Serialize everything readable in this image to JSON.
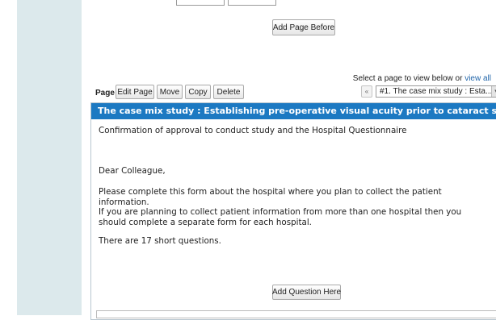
{
  "toolbar": {
    "add_page_before_label": "Add Page Before",
    "page_number": "Page #1",
    "edit_page_label": "Edit Page",
    "move_label": "Move",
    "copy_label": "Copy",
    "delete_label": "Delete"
  },
  "page_selector": {
    "instruction": "Select a page to view below or ",
    "view_all_link": "view all",
    "prev_symbol": "«",
    "selected_page": "#1. The case mix study : Esta...",
    "dropdown_arrow": "▾"
  },
  "page": {
    "title": "The case mix study : Establishing pre-operative visual acuity prior to cataract surgery",
    "paragraphs": [
      "Confirmation of approval to conduct study and the Hospital Questionnaire",
      "Dear Colleague,",
      "Please complete this form about the hospital where you plan to collect the patient information.",
      "If you are planning to collect patient information from more than one hospital then you should complete a separate form for each hospital.",
      "There are 17 short questions."
    ],
    "add_question_label": "Add Question Here"
  },
  "colors": {
    "header_blue": "#1c79c2",
    "left_panel": "#dce9ec",
    "link_blue": "#2266aa"
  }
}
